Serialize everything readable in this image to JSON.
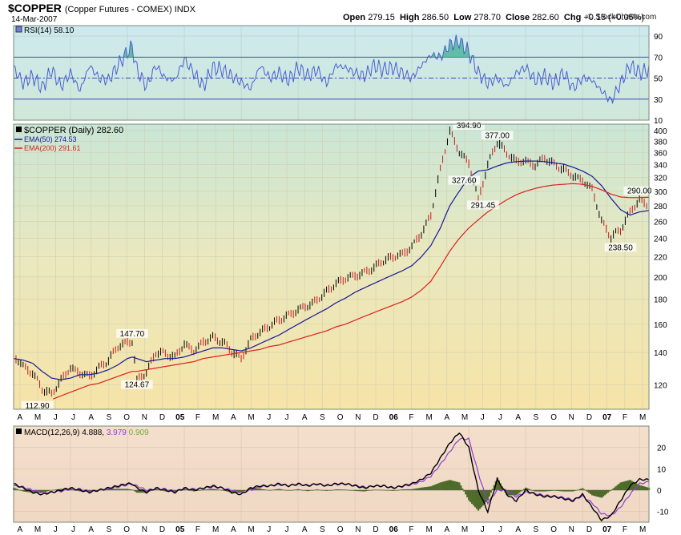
{
  "header": {
    "symbol": "$COPPER",
    "subtitle": "(Copper Futures - COMEX) INDX",
    "date": "14-Mar-2007",
    "open_label": "Open",
    "open": "279.15",
    "high_label": "High",
    "high": "286.50",
    "low_label": "Low",
    "low": "278.70",
    "close_label": "Close",
    "close": "282.60",
    "chg_label": "Chg",
    "chg": "+0.15 (+0.05%)",
    "brand": "© StockCharts.com"
  },
  "colors": {
    "rsi_line": "#4a5fd0",
    "ema50": "#17189a",
    "ema200": "#dd1f1f",
    "macd_line": "#000000",
    "macd_signal": "#8d3fd0",
    "histogram": "#4f6b2a",
    "price_up": "#000000",
    "price_down": "#c8191b"
  },
  "chart_data": [
    {
      "type": "line",
      "panel": "rsi",
      "legend": "RSI(14) 58.10",
      "ylim": [
        10,
        100
      ],
      "yticks": [
        "90",
        "70",
        "50",
        "30",
        "10"
      ],
      "reference_lines": [
        70,
        50,
        30
      ],
      "x_index": [
        0,
        12,
        24,
        36,
        48,
        60,
        72,
        84,
        96,
        108,
        120,
        132,
        144,
        150,
        156,
        168,
        180,
        192,
        204,
        216,
        228,
        240,
        252,
        264,
        276,
        288,
        300,
        312,
        324,
        336,
        348,
        360,
        372,
        384,
        396,
        408,
        420,
        432,
        444,
        456,
        468,
        480,
        492,
        504,
        516,
        528,
        540,
        552,
        564,
        576,
        588,
        600,
        612,
        624,
        636,
        648,
        660,
        672,
        684,
        696,
        708,
        720,
        732,
        744,
        756,
        768,
        780,
        792,
        804
      ],
      "values": [
        60,
        45,
        52,
        40,
        58,
        42,
        55,
        38,
        62,
        50,
        48,
        62,
        75,
        80,
        58,
        42,
        62,
        50,
        48,
        68,
        55,
        42,
        60,
        58,
        52,
        46,
        40,
        62,
        50,
        55,
        48,
        60,
        52,
        58,
        45,
        62,
        60,
        55,
        52,
        62,
        58,
        60,
        55,
        50,
        62,
        72,
        70,
        82,
        85,
        75,
        55,
        45,
        50,
        42,
        55,
        60,
        48,
        52,
        45,
        55,
        40,
        50,
        48,
        38,
        28,
        45,
        62,
        55,
        58
      ]
    },
    {
      "type": "line",
      "panel": "price",
      "title": "$COPPER (Daily) 282.60",
      "log_scale": true,
      "ylim": [
        107,
        412
      ],
      "yticks": [
        400,
        380,
        360,
        340,
        320,
        300,
        280,
        260,
        240,
        220,
        200,
        180,
        160,
        140,
        120
      ],
      "x_ticks": [
        "A",
        "M",
        "J",
        "J",
        "A",
        "S",
        "O",
        "N",
        "D",
        "05",
        "F",
        "M",
        "A",
        "M",
        "J",
        "J",
        "A",
        "S",
        "O",
        "N",
        "D",
        "06",
        "F",
        "M",
        "A",
        "M",
        "J",
        "J",
        "A",
        "S",
        "O",
        "N",
        "D",
        "07",
        "F",
        "M"
      ],
      "x_index": [
        0,
        12,
        24,
        36,
        48,
        60,
        72,
        84,
        96,
        108,
        120,
        132,
        144,
        150,
        156,
        168,
        180,
        192,
        204,
        216,
        228,
        240,
        252,
        264,
        276,
        288,
        300,
        312,
        324,
        336,
        348,
        360,
        372,
        384,
        396,
        408,
        420,
        432,
        444,
        456,
        468,
        480,
        492,
        504,
        516,
        528,
        540,
        552,
        564,
        576,
        588,
        600,
        612,
        624,
        636,
        648,
        660,
        672,
        684,
        696,
        708,
        720,
        732,
        744,
        756,
        768,
        780,
        792,
        804
      ],
      "series": [
        {
          "name": "$COPPER (Daily) 282.60",
          "values": [
            138,
            132,
            128,
            118,
            114,
            122,
            130,
            128,
            126,
            130,
            134,
            143,
            147,
            148,
            124,
            128,
            140,
            138,
            136,
            146,
            142,
            148,
            150,
            146,
            140,
            136,
            150,
            155,
            158,
            162,
            166,
            172,
            176,
            180,
            186,
            192,
            198,
            202,
            206,
            210,
            215,
            218,
            222,
            232,
            248,
            268,
            330,
            395,
            360,
            345,
            290,
            340,
            377,
            356,
            345,
            348,
            342,
            352,
            338,
            330,
            322,
            318,
            305,
            260,
            240,
            248,
            272,
            290,
            282
          ]
        },
        {
          "name": "EMA(50) 274.53",
          "values": [
            136,
            135,
            133,
            128,
            124,
            123,
            124,
            126,
            126,
            127,
            129,
            132,
            136,
            137,
            136,
            134,
            135,
            136,
            136,
            137,
            139,
            141,
            143,
            143,
            142,
            141,
            143,
            146,
            149,
            152,
            156,
            160,
            164,
            168,
            172,
            177,
            181,
            186,
            190,
            194,
            198,
            202,
            206,
            211,
            220,
            232,
            252,
            280,
            300,
            320,
            330,
            332,
            338,
            343,
            345,
            346,
            346,
            345,
            343,
            341,
            336,
            330,
            322,
            308,
            290,
            275,
            268,
            272,
            274
          ]
        },
        {
          "name": "EMA(200) 291.61",
          "values": [
            null,
            null,
            null,
            null,
            112,
            114,
            116,
            118,
            120,
            121,
            123,
            125,
            127,
            128,
            128,
            129,
            130,
            131,
            132,
            133,
            134,
            136,
            137,
            138,
            139,
            140,
            141,
            142,
            144,
            145,
            147,
            149,
            151,
            153,
            155,
            158,
            160,
            163,
            166,
            169,
            172,
            175,
            178,
            182,
            188,
            196,
            210,
            226,
            240,
            252,
            262,
            272,
            280,
            288,
            295,
            300,
            304,
            307,
            309,
            310,
            311,
            310,
            307,
            302,
            296,
            292,
            291,
            291,
            291.6
          ]
        }
      ],
      "annotations": [
        {
          "label": "112.90",
          "x": 30,
          "y": 112.9
        },
        {
          "label": "147.70",
          "x": 150,
          "y": 147.7
        },
        {
          "label": "124.67",
          "x": 156,
          "y": 124.67
        },
        {
          "label": "394.90",
          "x": 576,
          "y": 394.9
        },
        {
          "label": "327.60",
          "x": 570,
          "y": 327.6
        },
        {
          "label": "377.00",
          "x": 612,
          "y": 377
        },
        {
          "label": "291.45",
          "x": 594,
          "y": 291.45
        },
        {
          "label": "290.00",
          "x": 792,
          "y": 290
        },
        {
          "label": "238.50",
          "x": 768,
          "y": 238.5
        }
      ]
    },
    {
      "type": "line",
      "panel": "macd",
      "legend_label": "MACD(12,26,9)",
      "legend_macd": "4.888,",
      "legend_signal": "3.979",
      "legend_hist": "0.909",
      "ylim": [
        -15,
        30
      ],
      "yticks": [
        "20",
        "10",
        "0",
        "-10"
      ],
      "x_index": [
        0,
        12,
        24,
        36,
        48,
        60,
        72,
        84,
        96,
        108,
        120,
        132,
        144,
        150,
        156,
        168,
        180,
        192,
        204,
        216,
        228,
        240,
        252,
        264,
        276,
        288,
        300,
        312,
        324,
        336,
        348,
        360,
        372,
        384,
        396,
        408,
        420,
        432,
        444,
        456,
        468,
        480,
        492,
        504,
        516,
        528,
        540,
        552,
        564,
        576,
        588,
        600,
        612,
        624,
        636,
        648,
        660,
        672,
        684,
        696,
        708,
        720,
        732,
        744,
        756,
        768,
        780,
        792,
        804
      ],
      "series": [
        {
          "name": "MACD",
          "values": [
            3,
            1,
            -1,
            -2,
            -1,
            0,
            1,
            0,
            -1,
            0,
            1,
            2,
            3,
            3,
            1,
            -1,
            1,
            0,
            -1,
            1,
            0,
            1,
            2,
            1,
            -1,
            -2,
            1,
            2,
            2,
            3,
            2,
            3,
            2,
            3,
            2,
            3,
            3,
            2,
            1,
            2,
            2,
            1,
            2,
            3,
            5,
            8,
            15,
            22,
            27,
            20,
            0,
            -10,
            5,
            -2,
            -5,
            0,
            -2,
            -3,
            -3,
            -4,
            -5,
            -2,
            -8,
            -14,
            -12,
            -5,
            2,
            5,
            4.9
          ]
        },
        {
          "name": "Signal",
          "values": [
            2,
            1.5,
            0,
            -1,
            -1,
            -0.5,
            0.5,
            0.5,
            -0.5,
            0,
            0.5,
            1.5,
            2.5,
            2.8,
            2,
            0,
            0.5,
            0.5,
            -0.5,
            0.5,
            0.5,
            0.8,
            1.5,
            1,
            0,
            -1,
            0,
            1.5,
            2,
            2.5,
            2.2,
            2.6,
            2.4,
            2.7,
            2.3,
            2.7,
            2.8,
            2.3,
            1.5,
            1.8,
            1.9,
            1.3,
            1.7,
            2.6,
            4,
            6.5,
            12,
            18,
            24,
            24,
            8,
            -6,
            0,
            0,
            -3,
            -1,
            -1.5,
            -2.5,
            -2.8,
            -3.5,
            -4.5,
            -2.8,
            -6,
            -11,
            -12,
            -8,
            -2,
            3,
            3.98
          ]
        }
      ]
    }
  ]
}
